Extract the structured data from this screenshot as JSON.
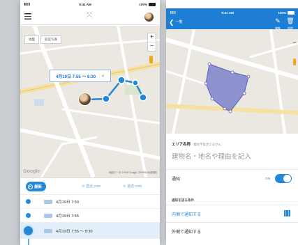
{
  "left_phone": {
    "status": {
      "time": "9:41 AM",
      "battery": "100%"
    },
    "map_buttons": [
      "地図",
      "航空写真"
    ],
    "zoom_in": "+",
    "zoom_out": "−",
    "callout": {
      "text": "4月19日 7:55 〜 8:30",
      "close": "✕"
    },
    "map_attribution": "地図データ ©2018 Google, ZENRIN 利用規約",
    "google_logo": "Google",
    "toolbar": {
      "latest": "最新",
      "prev": "直近.com",
      "next": "過去.com"
    },
    "history": [
      {
        "label": "4月19日 7:50",
        "selected": false
      },
      {
        "label": "4月19日 7:55",
        "selected": false
      },
      {
        "label": "4月19日 7:55 〜 8:30",
        "selected": true
      }
    ]
  },
  "right_phone": {
    "status": {
      "time": "9:41 AM",
      "battery": "100%"
    },
    "header": {
      "back_label": "一覧",
      "edit_label": "編集",
      "delete_label": "削除"
    },
    "area_name": {
      "label": "エリア名称",
      "hint": "都文字は見えません",
      "placeholder": "建物名・地名や理由を記入"
    },
    "notify": {
      "label": "通知",
      "state_label": "ON"
    },
    "condition_section": "通知を送る条件",
    "conditions": [
      {
        "label": "内側で通知する",
        "selected": true
      },
      {
        "label": "外側で通知する",
        "selected": false
      }
    ]
  },
  "colors": {
    "accent": "#2488d8",
    "header_blue": "#1e7ed4",
    "polygon_fill": "#6f75c8"
  }
}
